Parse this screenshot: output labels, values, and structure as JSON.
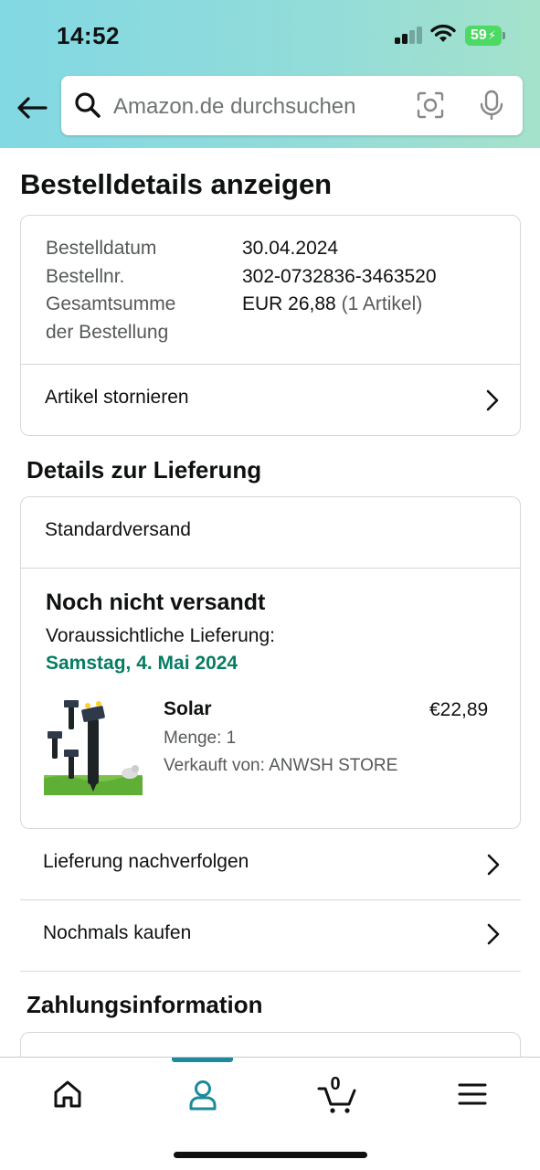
{
  "status_bar": {
    "time": "14:52",
    "battery": "59"
  },
  "search": {
    "placeholder": "Amazon.de durchsuchen"
  },
  "page_title": "Bestelldetails anzeigen",
  "order_summary": {
    "date_label": "Bestelldatum",
    "date_value": "30.04.2024",
    "number_label": "Bestellnr.",
    "number_value": "302-0732836-3463520",
    "total_label_line1": "Gesamtsumme",
    "total_label_line2": "der Bestellung",
    "total_value": "EUR 26,88",
    "total_items": "(1 Artikel)",
    "cancel_label": "Artikel stornieren"
  },
  "delivery": {
    "section_title": "Details zur Lieferung",
    "shipping_method": "Standardversand",
    "status": "Noch nicht versandt",
    "eta_label": "Voraussichtliche Lieferung:",
    "eta_date": "Samstag, 4. Mai 2024",
    "item": {
      "name": "Solar",
      "quantity": "Menge: 1",
      "seller": "Verkauft von: ANWSH STORE",
      "price": "€22,89"
    },
    "track_label": "Lieferung nachverfolgen",
    "buy_again_label": "Nochmals kaufen"
  },
  "payment": {
    "section_title": "Zahlungsinformation"
  },
  "tabbar": {
    "tabs": [
      "home-icon",
      "account-icon",
      "cart-icon",
      "menu-icon"
    ],
    "active": "account-icon",
    "cart_count": "0"
  },
  "colors": {
    "accent": "#1b8a9a",
    "eta_green": "#067d62",
    "header_start": "#82d8e3",
    "header_end": "#a5e2cb"
  }
}
